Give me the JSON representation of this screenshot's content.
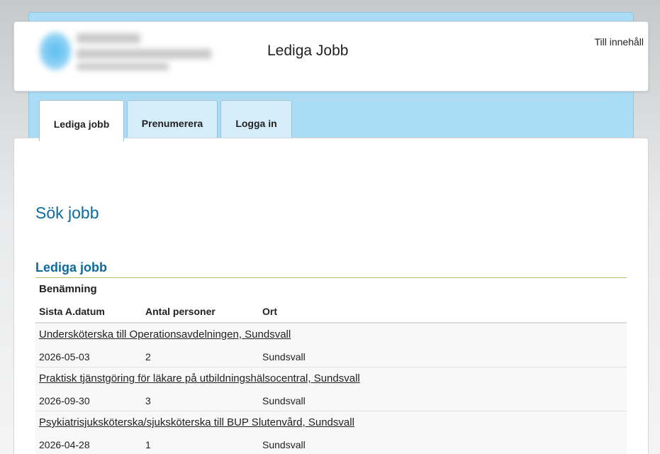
{
  "header": {
    "title": "Lediga Jobb",
    "skip_link": "Till innehåll"
  },
  "tabs": [
    {
      "label": "Lediga jobb",
      "active": true
    },
    {
      "label": "Prenumerera",
      "active": false
    },
    {
      "label": "Logga in",
      "active": false
    }
  ],
  "main": {
    "page_heading": "Sök jobb",
    "section_heading": "Lediga jobb",
    "table": {
      "main_header": "Benämning",
      "columns": [
        "Sista A.datum",
        "Antal personer",
        "Ort"
      ],
      "rows": [
        {
          "title": "Undersköterska till Operationsavdelningen, Sundsvall",
          "date": "2026-05-03",
          "count": "2",
          "place": "Sundsvall"
        },
        {
          "title": "Praktisk tjänstgöring för läkare på utbildningshälsocentral, Sundsvall",
          "date": "2026-09-30",
          "count": "3",
          "place": "Sundsvall"
        },
        {
          "title": "Psykiatrisjuksköterska/sjuksköterska till BUP Slutenvård, Sundsvall",
          "date": "2026-04-28",
          "count": "1",
          "place": "Sundsvall"
        }
      ]
    }
  },
  "colors": {
    "frame_blue": "#abdcf5",
    "heading_blue": "#0f6b9e",
    "tab_inactive": "#d5edf9",
    "section_rule": "#b8bd6c"
  }
}
